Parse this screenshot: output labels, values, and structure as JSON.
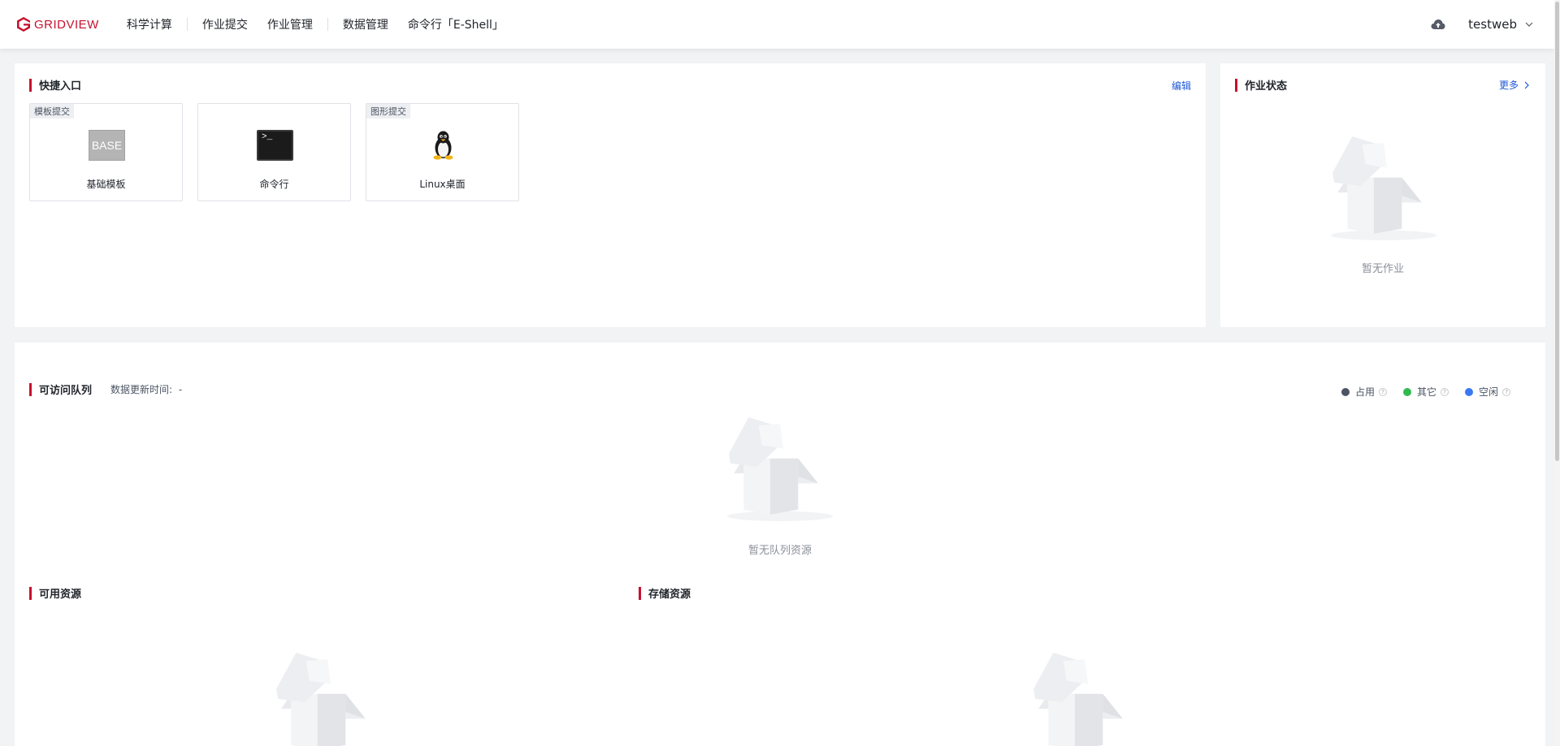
{
  "brand": {
    "logo_text": "GRIDVIEW",
    "color": "#c8102e"
  },
  "nav": {
    "items": [
      "科学计算",
      "作业提交",
      "作业管理",
      "数据管理",
      "命令行「E-Shell」"
    ]
  },
  "user": {
    "name": "testweb",
    "cloud_icon": "cloud-upload-icon"
  },
  "quick_entry": {
    "title": "快捷入口",
    "edit_label": "编辑",
    "tiles": [
      {
        "tag": "模板提交",
        "icon": "base-template-icon",
        "icon_text": "BASE",
        "label": "基础模板"
      },
      {
        "tag": "",
        "icon": "terminal-icon",
        "icon_text": ">_",
        "label": "命令行"
      },
      {
        "tag": "图形提交",
        "icon": "linux-penguin-icon",
        "icon_text": "",
        "label": "Linux桌面"
      }
    ]
  },
  "job_status": {
    "title": "作业状态",
    "more_label": "更多",
    "empty_text": "暂无作业"
  },
  "queue": {
    "title": "可访问队列",
    "update_label": "数据更新时间:",
    "update_value": "-",
    "empty_text": "暂无队列资源",
    "legend": [
      {
        "label": "占用",
        "color": "#4b5563",
        "help": "?"
      },
      {
        "label": "其它",
        "color": "#2fb94f",
        "help": "?"
      },
      {
        "label": "空闲",
        "color": "#3a78f2",
        "help": "?"
      }
    ]
  },
  "available": {
    "title": "可用资源"
  },
  "storage": {
    "title": "存储资源"
  }
}
